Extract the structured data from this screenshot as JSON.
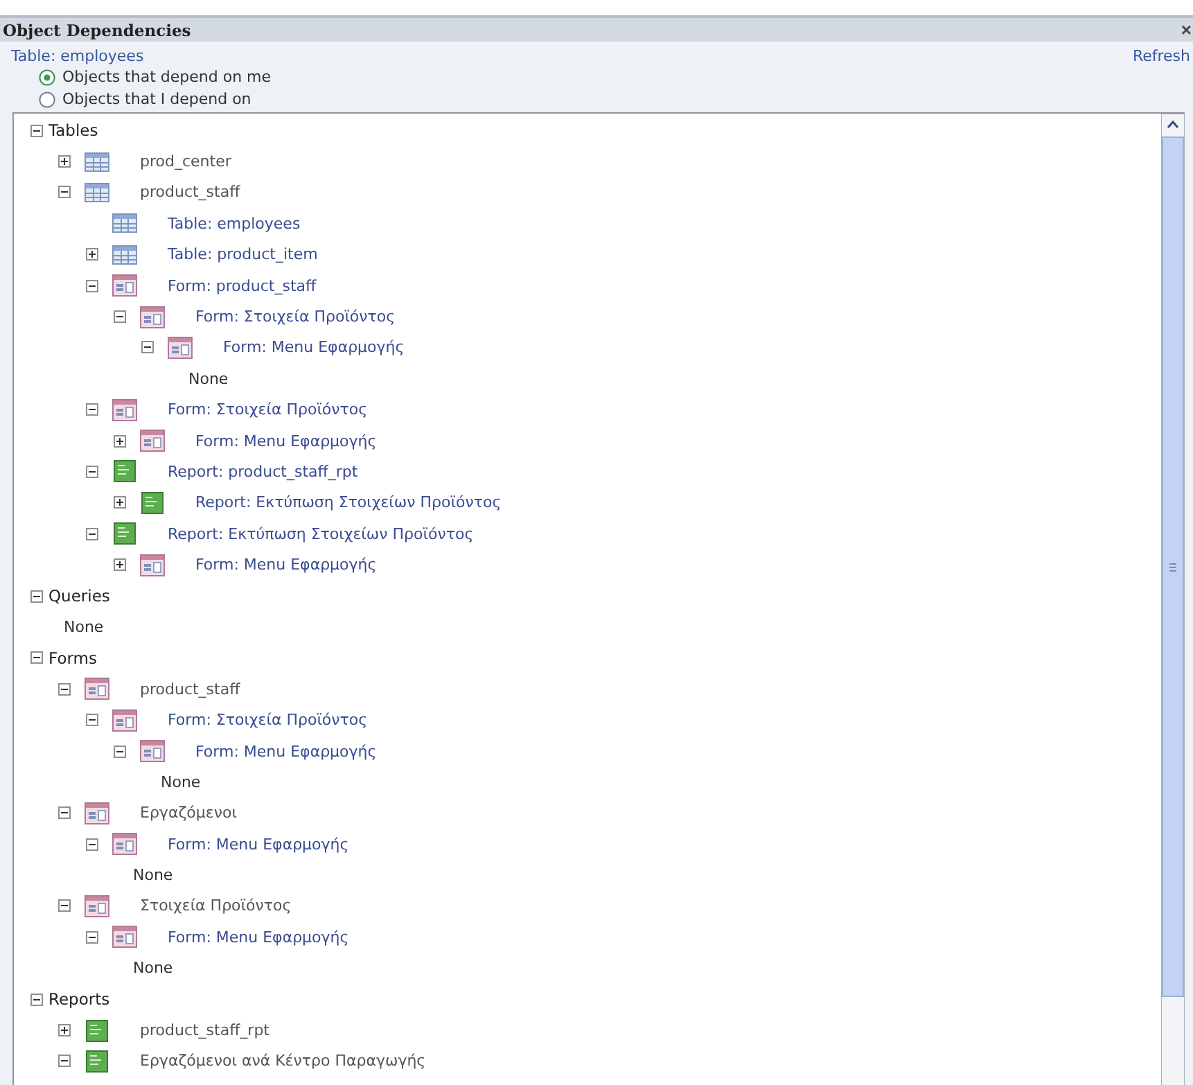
{
  "window": {
    "title": "Object Dependencies",
    "close": "×"
  },
  "object_label": "Table: employees",
  "refresh": "Refresh",
  "options": [
    {
      "label": "Objects that depend on me",
      "selected": true
    },
    {
      "label": "Objects that I depend on",
      "selected": false
    }
  ],
  "tree": [
    {
      "label": "Tables",
      "kind": "category",
      "expanded": true,
      "children": [
        {
          "label": "prod_center",
          "kind": "table",
          "expanded": false
        },
        {
          "label": "product_staff",
          "kind": "table",
          "expanded": true,
          "children": [
            {
              "label": "Table: employees",
              "kind": "table"
            },
            {
              "label": "Table: product_item",
              "kind": "table",
              "expanded": false
            },
            {
              "label": "Form: product_staff",
              "kind": "form",
              "expanded": true,
              "children": [
                {
                  "label": "Form: Στοιχεία Προϊόντος",
                  "kind": "form",
                  "expanded": true,
                  "children": [
                    {
                      "label": "Form: Menu Εφαρμογής",
                      "kind": "form",
                      "expanded": true,
                      "children": [
                        {
                          "label": "None",
                          "kind": "none"
                        }
                      ]
                    }
                  ]
                }
              ]
            },
            {
              "label": "Form: Στοιχεία Προϊόντος",
              "kind": "form",
              "expanded": true,
              "children": [
                {
                  "label": "Form: Menu Εφαρμογής",
                  "kind": "form",
                  "expanded": false
                }
              ]
            },
            {
              "label": "Report: product_staff_rpt",
              "kind": "report",
              "expanded": true,
              "children": [
                {
                  "label": "Report: Εκτύπωση Στοιχείων Προϊόντος",
                  "kind": "report",
                  "expanded": false
                }
              ]
            },
            {
              "label": "Report: Εκτύπωση Στοιχείων Προϊόντος",
              "kind": "report",
              "expanded": true,
              "children": [
                {
                  "label": "Form: Menu Εφαρμογής",
                  "kind": "form",
                  "expanded": false
                }
              ]
            }
          ]
        }
      ]
    },
    {
      "label": "Queries",
      "kind": "category",
      "expanded": true,
      "children": [
        {
          "label": "None",
          "kind": "none"
        }
      ]
    },
    {
      "label": "Forms",
      "kind": "category",
      "expanded": true,
      "children": [
        {
          "label": "product_staff",
          "kind": "form",
          "expanded": true,
          "children": [
            {
              "label": "Form: Στοιχεία Προϊόντος",
              "kind": "form",
              "expanded": true,
              "children": [
                {
                  "label": "Form: Menu Εφαρμογής",
                  "kind": "form",
                  "expanded": true,
                  "children": [
                    {
                      "label": "None",
                      "kind": "none"
                    }
                  ]
                }
              ]
            }
          ]
        },
        {
          "label": "Εργαζόμενοι",
          "kind": "form",
          "expanded": true,
          "children": [
            {
              "label": "Form: Menu Εφαρμογής",
              "kind": "form",
              "expanded": true,
              "children": [
                {
                  "label": "None",
                  "kind": "none"
                }
              ]
            }
          ]
        },
        {
          "label": "Στοιχεία Προϊόντος",
          "kind": "form",
          "expanded": true,
          "children": [
            {
              "label": "Form: Menu Εφαρμογής",
              "kind": "form",
              "expanded": true,
              "children": [
                {
                  "label": "None",
                  "kind": "none"
                }
              ]
            }
          ]
        }
      ]
    },
    {
      "label": "Reports",
      "kind": "category",
      "expanded": true,
      "children": [
        {
          "label": "product_staff_rpt",
          "kind": "report",
          "expanded": false
        },
        {
          "label": "Εργαζόμενοι ανά Κέντρο Παραγωγής",
          "kind": "report",
          "expanded": true
        }
      ]
    }
  ]
}
